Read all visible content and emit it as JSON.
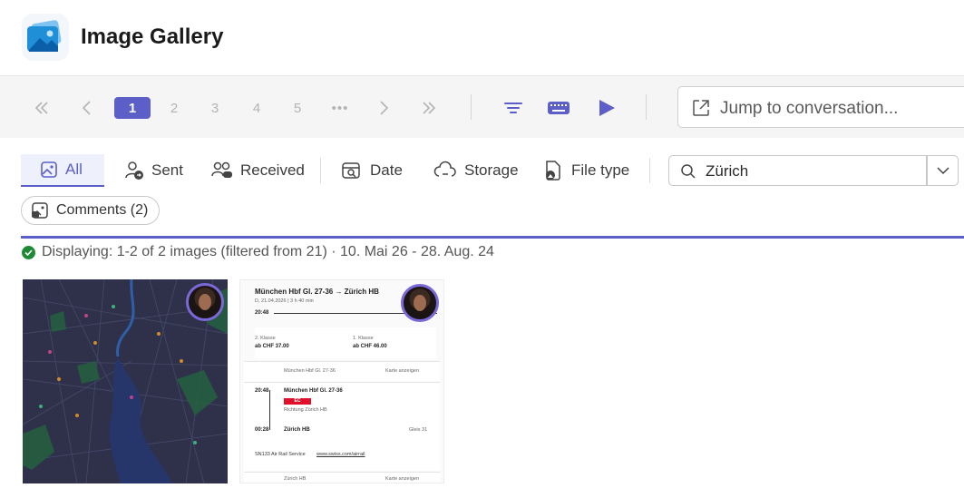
{
  "header": {
    "title": "Image Gallery",
    "icon": "gallery-app-icon"
  },
  "pagination": {
    "pages": [
      "1",
      "2",
      "3",
      "4",
      "5"
    ],
    "ellipsis": "•••",
    "active_page": "1"
  },
  "jump": {
    "placeholder": "Jump to conversation..."
  },
  "filters": {
    "tabs": [
      {
        "label": "All",
        "icon": "image-icon",
        "active": true
      },
      {
        "label": "Sent",
        "icon": "person-send-icon"
      },
      {
        "label": "Received",
        "icon": "people-chat-icon"
      },
      {
        "label": "Date",
        "icon": "calendar-search-icon"
      },
      {
        "label": "Storage",
        "icon": "cloud-link-icon"
      },
      {
        "label": "File type",
        "icon": "file-image-icon"
      }
    ],
    "search_value": "Zürich",
    "comments_chip": "Comments (2)"
  },
  "status": {
    "text": "Displaying: 1-2 of 2 images (filtered from 21) · 10. Mai 26 - 28. Aug. 24"
  },
  "images": {
    "ticket": {
      "title": "München Hbf Gl. 27-36 → Zürich HB",
      "date_line": "D, 21.04.2026 | 3 h 40 min",
      "depart_time": "20:48",
      "class2": "2. Klasse",
      "class2_price": "ab CHF 37.00",
      "class1": "1. Klasse",
      "class1_price": "ab CHF 46.00",
      "stop1": "München Hbf Gl. 27-36",
      "map_link": "Karte anzeigen",
      "seg_time1": "20:48",
      "seg_from": "München Hbf Gl. 27-36",
      "seg_train": "EC",
      "seg_dir": "Richtung Zürich HB",
      "seg_time2": "00:28",
      "seg_to": "Zürich HB",
      "seg_platform": "Gleis 31",
      "note": "SN133 Air Rail Service",
      "note_link": "www.swiss.com/airrail",
      "stop2": "Zürich HB"
    }
  },
  "colors": {
    "accent": "#5b5fc7",
    "ok": "#1f8a36"
  }
}
